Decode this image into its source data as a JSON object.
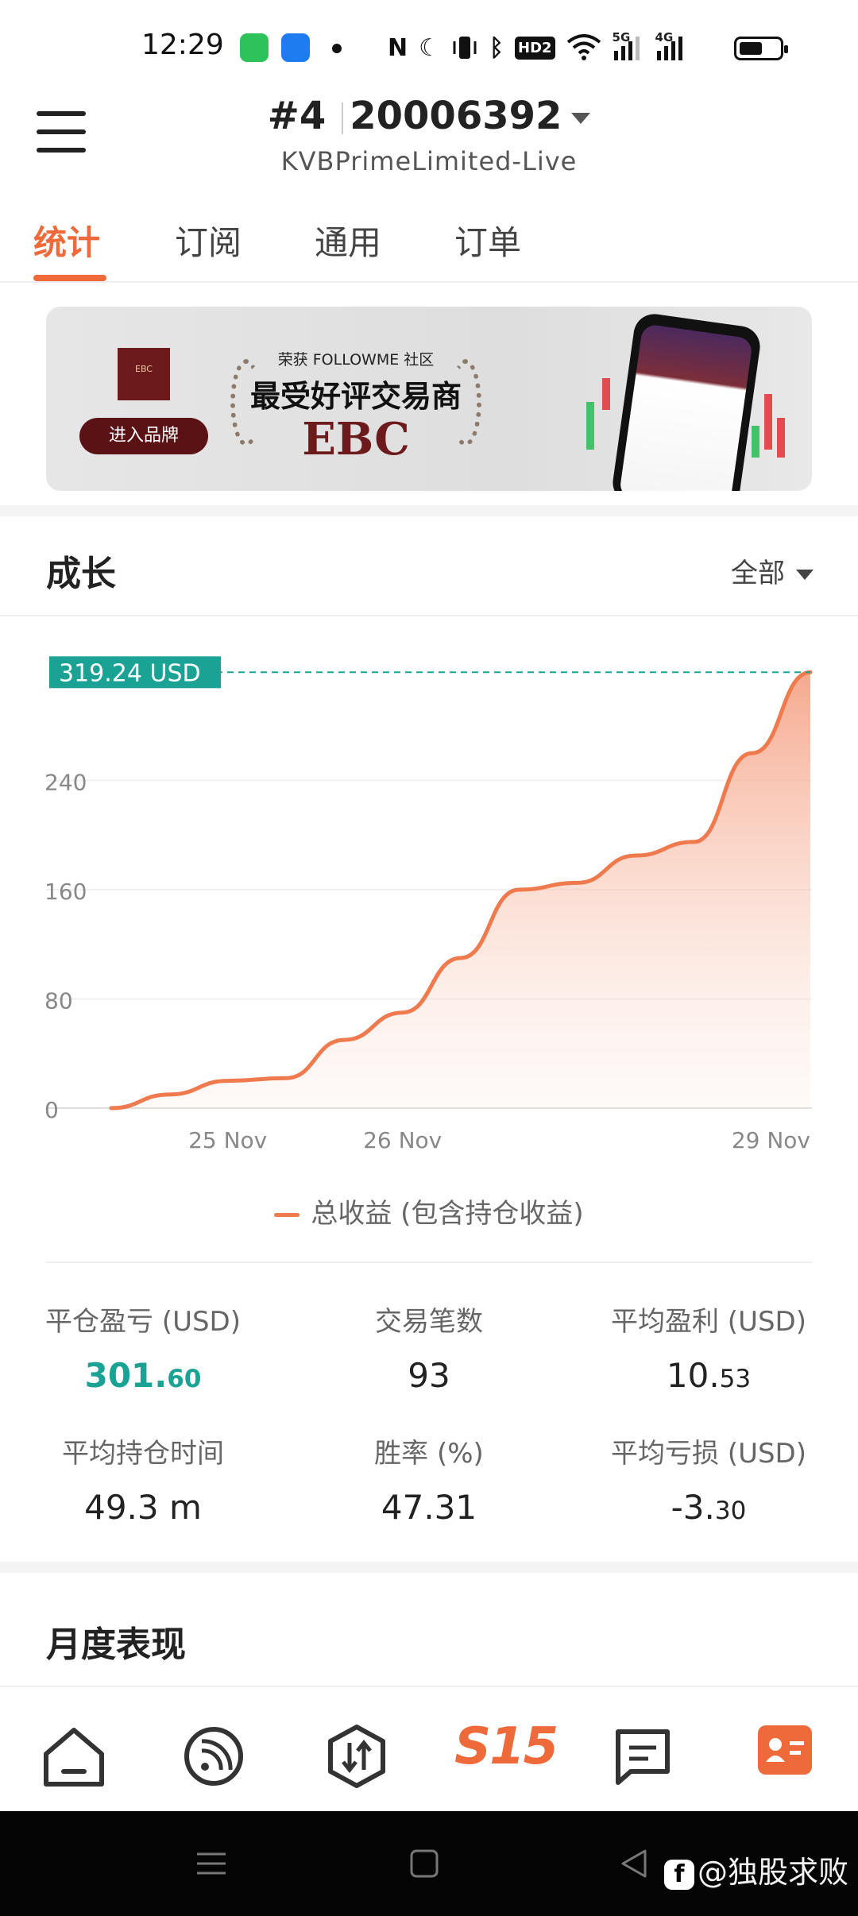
{
  "status_bar": {
    "time": "12:29",
    "icons": [
      "phone-app-icon",
      "shield-app-icon",
      "notification-dot",
      "nfc-icon",
      "moon-icon",
      "vibrate-icon",
      "bluetooth-icon",
      "hd-icon",
      "wifi-icon",
      "5g-signal-icon",
      "4g-signal-icon",
      "battery-icon"
    ],
    "nfc_glyph": "N",
    "moon_glyph": "☾",
    "bluetooth_glyph": "ᛒ",
    "hd_label": "HD2",
    "net1": "5G",
    "net2": "4G"
  },
  "header": {
    "rank": "#4",
    "account_number": "20006392",
    "server": "KVBPrimeLimited-Live"
  },
  "tabs": [
    "统计",
    "订阅",
    "通用",
    "订单"
  ],
  "active_tab": 0,
  "banner": {
    "logo_text": "EBC",
    "button_label": "进入品牌",
    "award_subtitle": "荣获 FOLLOWME 社区",
    "award_title": "最受好评交易商",
    "brand": "EBC"
  },
  "growth": {
    "title": "成长",
    "range": "全部",
    "legend": "总收益 (包含持仓收益)"
  },
  "chart_data": {
    "type": "area",
    "x": [
      "24 Nov",
      "24.5 Nov",
      "25 Nov",
      "25.3 Nov",
      "25.6 Nov",
      "26 Nov",
      "26.4 Nov",
      "26.8 Nov",
      "27.3 Nov",
      "27.8 Nov",
      "28.3 Nov",
      "28.6 Nov",
      "29 Nov"
    ],
    "values": [
      0,
      10,
      20,
      22,
      50,
      70,
      110,
      160,
      165,
      185,
      195,
      260,
      319.24
    ],
    "x_tick_labels": [
      "25 Nov",
      "26 Nov",
      "29 Nov"
    ],
    "y_tick_labels": [
      "0",
      "80",
      "160",
      "240"
    ],
    "ylim": [
      0,
      320
    ],
    "current_value_label": "319.24 USD",
    "line_color": "#ef7a4e",
    "marker_color": "#1aa394",
    "grid": true
  },
  "stats": [
    {
      "label": "平仓盈亏 (USD)",
      "value_int": "301.",
      "value_dec": "60",
      "color": "#1aa394"
    },
    {
      "label": "交易笔数",
      "value_int": "93",
      "value_dec": ""
    },
    {
      "label": "平均盈利 (USD)",
      "value_int": "10.",
      "value_dec": "53"
    },
    {
      "label": "平均持仓时间",
      "value_int": "49.3 m",
      "value_dec": ""
    },
    {
      "label": "胜率 (%)",
      "value_int": "47.31",
      "value_dec": ""
    },
    {
      "label": "平均亏损 (USD)",
      "value_int": "-3.",
      "value_dec": "30"
    }
  ],
  "monthly": {
    "title": "月度表现"
  },
  "bottom_nav": [
    "home-icon",
    "feed-icon",
    "trade-icon",
    "s15-icon",
    "messages-icon",
    "profile-icon"
  ],
  "bottom_nav_s15": "S15",
  "watermark": "@独股求败",
  "watermark_logo": "f"
}
